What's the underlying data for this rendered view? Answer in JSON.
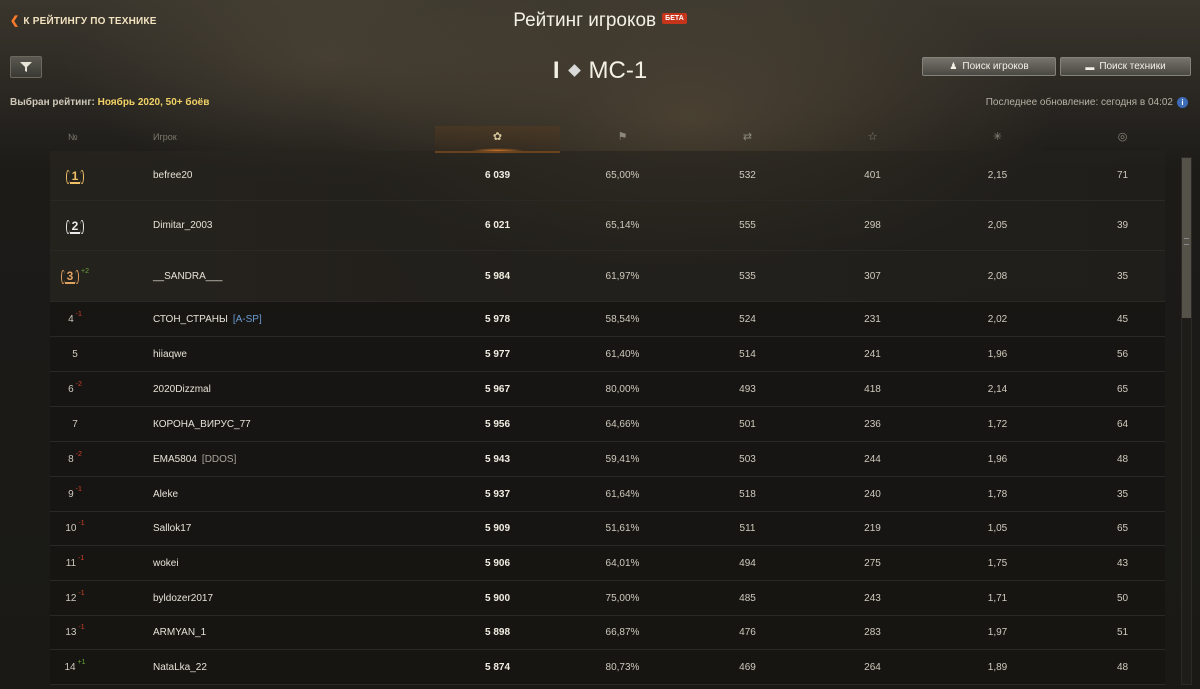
{
  "header": {
    "back_link": "К РЕЙТИНГУ ПО ТЕХНИКЕ",
    "title": "Рейтинг игроков",
    "badge": "БЕТА",
    "vehicle_tier": "I",
    "vehicle_name": "МС-1"
  },
  "toolbar": {
    "search_players": "Поиск игроков",
    "search_vehicles": "Поиск техники"
  },
  "selected_rating": {
    "label": "Выбран рейтинг:",
    "value": "Ноябрь 2020, 50+ боёв"
  },
  "last_update": "Последнее обновление: сегодня в 04:02",
  "columns": {
    "rank": "№",
    "player": "Игрок"
  },
  "rows": [
    {
      "rank": "1",
      "medal": "gold",
      "delta": "",
      "name": "befree20",
      "clan": "",
      "score": "6 039",
      "win": "65,00%",
      "dmg": "532",
      "xp": "401",
      "kills": "2,15",
      "spot": "71"
    },
    {
      "rank": "2",
      "medal": "silver",
      "delta": "",
      "name": "Dimitar_2003",
      "clan": "",
      "score": "6 021",
      "win": "65,14%",
      "dmg": "555",
      "xp": "298",
      "kills": "2,05",
      "spot": "39"
    },
    {
      "rank": "3",
      "medal": "bronze",
      "delta": "+2",
      "name": "__SANDRA___",
      "clan": "",
      "score": "5 984",
      "win": "61,97%",
      "dmg": "535",
      "xp": "307",
      "kills": "2,08",
      "spot": "35"
    },
    {
      "rank": "4",
      "medal": "",
      "delta": "-1",
      "name": "СТОН_СТРАНЫ",
      "clan": "[A-SP]",
      "score": "5 978",
      "win": "58,54%",
      "dmg": "524",
      "xp": "231",
      "kills": "2,02",
      "spot": "45"
    },
    {
      "rank": "5",
      "medal": "",
      "delta": "",
      "name": "hiiaqwe",
      "clan": "",
      "score": "5 977",
      "win": "61,40%",
      "dmg": "514",
      "xp": "241",
      "kills": "1,96",
      "spot": "56"
    },
    {
      "rank": "6",
      "medal": "",
      "delta": "-2",
      "name": "2020Dizzmal",
      "clan": "",
      "score": "5 967",
      "win": "80,00%",
      "dmg": "493",
      "xp": "418",
      "kills": "2,14",
      "spot": "65"
    },
    {
      "rank": "7",
      "medal": "",
      "delta": "",
      "name": "КОРОНА_ВИРУС_77",
      "clan": "",
      "score": "5 956",
      "win": "64,66%",
      "dmg": "501",
      "xp": "236",
      "kills": "1,72",
      "spot": "64"
    },
    {
      "rank": "8",
      "medal": "",
      "delta": "-2",
      "name": "EMA5804",
      "clan": "[DDOS]",
      "score": "5 943",
      "win": "59,41%",
      "dmg": "503",
      "xp": "244",
      "kills": "1,96",
      "spot": "48"
    },
    {
      "rank": "9",
      "medal": "",
      "delta": "-1",
      "name": "Aleke",
      "clan": "",
      "score": "5 937",
      "win": "61,64%",
      "dmg": "518",
      "xp": "240",
      "kills": "1,78",
      "spot": "35"
    },
    {
      "rank": "10",
      "medal": "",
      "delta": "-1",
      "name": "Sallok17",
      "clan": "",
      "score": "5 909",
      "win": "51,61%",
      "dmg": "511",
      "xp": "219",
      "kills": "1,05",
      "spot": "65"
    },
    {
      "rank": "11",
      "medal": "",
      "delta": "-1",
      "name": "wokei",
      "clan": "",
      "score": "5 906",
      "win": "64,01%",
      "dmg": "494",
      "xp": "275",
      "kills": "1,75",
      "spot": "43"
    },
    {
      "rank": "12",
      "medal": "",
      "delta": "-1",
      "name": "byldozer2017",
      "clan": "",
      "score": "5 900",
      "win": "75,00%",
      "dmg": "485",
      "xp": "243",
      "kills": "1,71",
      "spot": "50"
    },
    {
      "rank": "13",
      "medal": "",
      "delta": "-1",
      "name": "ARMYAN_1",
      "clan": "",
      "score": "5 898",
      "win": "66,87%",
      "dmg": "476",
      "xp": "283",
      "kills": "1,97",
      "spot": "51"
    },
    {
      "rank": "14",
      "medal": "",
      "delta": "+1",
      "name": "NataLka_22",
      "clan": "",
      "score": "5 874",
      "win": "80,73%",
      "dmg": "469",
      "xp": "264",
      "kills": "1,89",
      "spot": "48"
    }
  ],
  "colors": {
    "accent": "#e07a1c",
    "score_highlight": "#f2d266",
    "delta_down": "#d0402a",
    "delta_up": "#69a83a",
    "clan": "#6a9ad0"
  }
}
